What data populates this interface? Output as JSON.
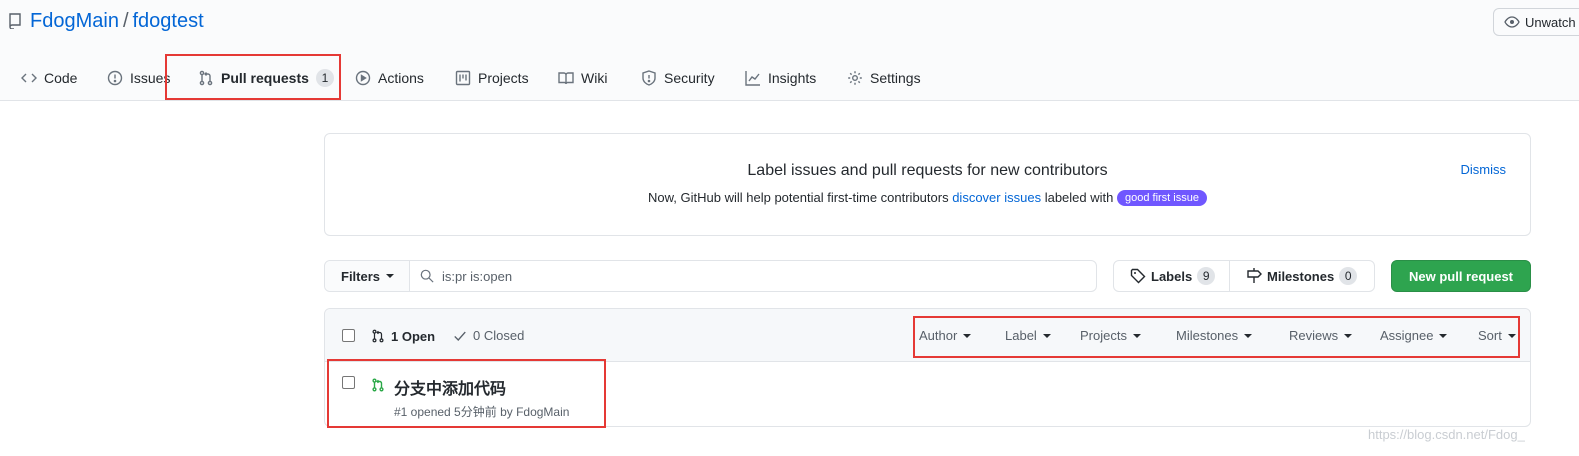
{
  "header": {
    "owner": "FdogMain",
    "separator": "/",
    "repo": "fdogtest",
    "watch_label": "Unwatch"
  },
  "tabs": [
    {
      "label": "Code",
      "icon": "code-icon"
    },
    {
      "label": "Issues",
      "icon": "issue-icon"
    },
    {
      "label": "Pull requests",
      "icon": "git-pull-request-icon",
      "count": "1",
      "selected": true
    },
    {
      "label": "Actions",
      "icon": "play-icon"
    },
    {
      "label": "Projects",
      "icon": "project-icon"
    },
    {
      "label": "Wiki",
      "icon": "book-icon"
    },
    {
      "label": "Security",
      "icon": "shield-icon"
    },
    {
      "label": "Insights",
      "icon": "graph-icon"
    },
    {
      "label": "Settings",
      "icon": "gear-icon"
    }
  ],
  "banner": {
    "title": "Label issues and pull requests for new contributors",
    "text_before": "Now, GitHub will help potential first-time contributors",
    "link": "discover issues",
    "text_after": "labeled with",
    "label": "good first issue",
    "label_color": "#7057ff",
    "dismiss": "Dismiss"
  },
  "toolbar": {
    "filters_label": "Filters",
    "search_value": "is:pr is:open",
    "labels_label": "Labels",
    "labels_count": "9",
    "milestones_label": "Milestones",
    "milestones_count": "0",
    "new_pr_label": "New pull request"
  },
  "list": {
    "open_label": "1 Open",
    "closed_label": "0 Closed",
    "filters": [
      "Author",
      "Label",
      "Projects",
      "Milestones",
      "Reviews",
      "Assignee",
      "Sort"
    ],
    "items": [
      {
        "title": "分支中添加代码",
        "meta": "#1 opened 5分钟前 by FdogMain"
      }
    ]
  },
  "watermark": "https://blog.csdn.net/Fdog_",
  "colors": {
    "accent": "#0366d6",
    "primary_button": "#2ea44f",
    "highlight": "#e53935",
    "open_icon": "#28a745"
  }
}
